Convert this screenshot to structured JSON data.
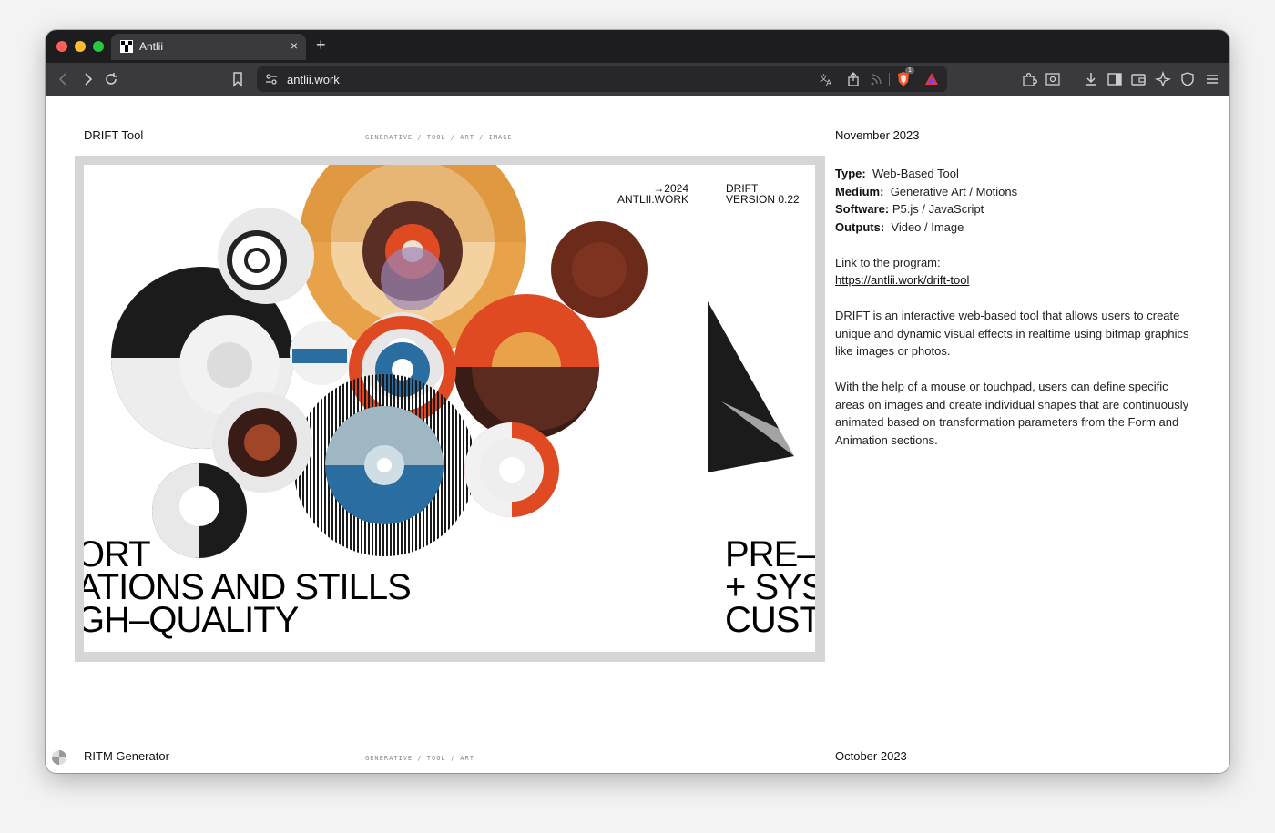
{
  "browser": {
    "tab_title": "Antlii",
    "tab_close": "×",
    "new_tab": "+",
    "url": "antlii.work",
    "shield_badge": "1"
  },
  "project1": {
    "title": "DRIFT Tool",
    "tags": "GENERATIVE / TOOL / ART / IMAGE",
    "date": "November 2023",
    "type_label": "Type:",
    "type_value": "Web-Based Tool",
    "medium_label": "Medium:",
    "medium_value": "Generative Art / Motions",
    "software_label": "Software:",
    "software_value": "P5.js / JavaScript",
    "outputs_label": "Outputs:",
    "outputs_value": "Video / Image",
    "link_intro": "Link to the program:",
    "link": "https://antlii.work/drift-tool",
    "para1": "DRIFT is an interactive web-based tool that allows users to create unique and dynamic visual effects in realtime using bitmap graphics like images or photos.",
    "para2": "With the help of a mouse or touchpad, users can define specific areas on images and create individual shapes that are continuously animated based on transformation parameters from the Form and Animation sections."
  },
  "artwork": {
    "year": "→2024",
    "site": "ANTLII.WORK",
    "drift": "DRIFT",
    "version": "VERSION 0.22",
    "left_line1": "ORT",
    "left_line2": "ATIONS AND STILLS",
    "left_line3": "GH–QUALITY",
    "right_line1": "PRE–",
    "right_line2": "+ SYS",
    "right_line3": "CUST"
  },
  "project2": {
    "title": "RITM Generator",
    "tags": "GENERATIVE / TOOL / ART",
    "date": "October 2023"
  },
  "colors": {
    "orange": "#e8a24a",
    "red": "#e04a22",
    "blue": "#2a6da0",
    "brown": "#6b2a1a"
  }
}
